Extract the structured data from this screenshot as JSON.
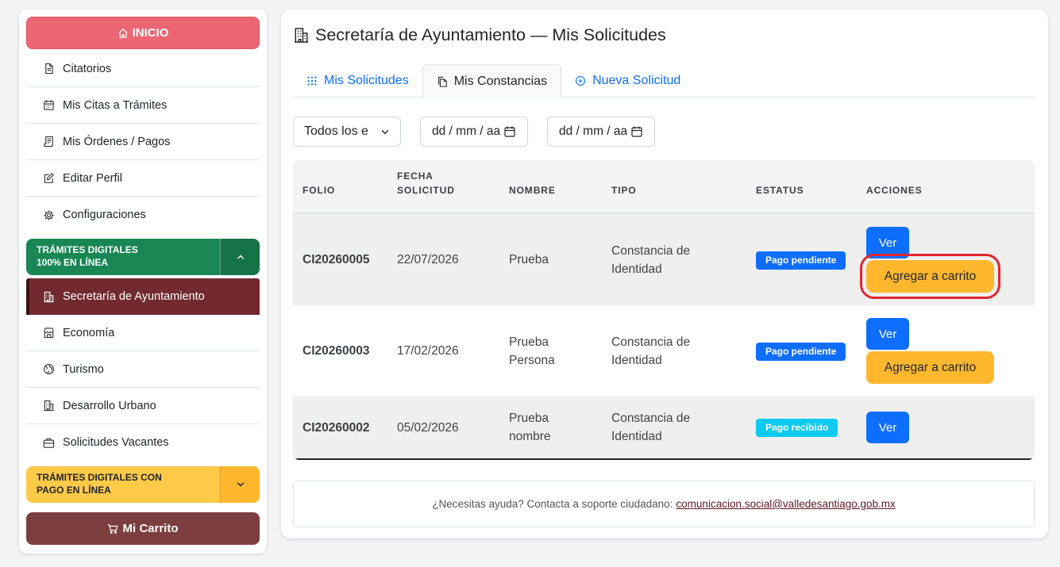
{
  "sidebar": {
    "inicio_label": "INICIO",
    "menu": [
      {
        "label": "Citatorios",
        "icon": "document-icon"
      },
      {
        "label": "Mis Citas a Trámites",
        "icon": "calendar-icon"
      },
      {
        "label": "Mis Órdenes / Pagos",
        "icon": "receipt-icon"
      },
      {
        "label": "Editar Perfil",
        "icon": "edit-icon"
      },
      {
        "label": "Configuraciones",
        "icon": "gear-icon"
      }
    ],
    "section_digital": {
      "line1": "TRÁMITES DIGITALES",
      "line2": "100% EN LÍNEA"
    },
    "digital_items": [
      {
        "label": "Secretaría de Ayuntamiento",
        "icon": "building-icon",
        "active": true
      },
      {
        "label": "Economía",
        "icon": "shop-icon"
      },
      {
        "label": "Turismo",
        "icon": "globe-icon"
      },
      {
        "label": "Desarrollo Urbano",
        "icon": "building-icon"
      },
      {
        "label": "Solicitudes Vacantes",
        "icon": "briefcase-icon"
      }
    ],
    "section_pago": {
      "line1": "TRÁMITES DIGITALES CON",
      "line2": "PAGO EN LÍNEA"
    },
    "carrito_label": "Mi Carrito"
  },
  "main": {
    "title": "Secretaría de Ayuntamiento — Mis Solicitudes",
    "tabs": [
      {
        "label": "Mis Solicitudes",
        "icon": "grid-dots-icon"
      },
      {
        "label": "Mis Constancias",
        "icon": "files-icon",
        "active": true
      },
      {
        "label": "Nueva Solicitud",
        "icon": "plus-circle-icon"
      }
    ],
    "filters": {
      "status_value": "Todos los e",
      "date_from": "dd / mm / aa",
      "date_to": "dd / mm / aa"
    },
    "table": {
      "headers": {
        "folio": "FOLIO",
        "fecha_1": "FECHA",
        "fecha_2": "SOLICITUD",
        "nombre": "NOMBRE",
        "tipo": "TIPO",
        "estatus": "ESTATUS",
        "acciones": "ACCIONES"
      },
      "rows": [
        {
          "folio": "CI20260005",
          "fecha": "22/07/2026",
          "nombre_1": "Prueba",
          "nombre_2": "",
          "tipo_1": "Constancia de",
          "tipo_2": "Identidad",
          "estatus": "Pago pendiente",
          "ver": "Ver",
          "cart": "Agregar a carrito"
        },
        {
          "folio": "CI20260003",
          "fecha": "17/02/2026",
          "nombre_1": "Prueba",
          "nombre_2": "Persona",
          "tipo_1": "Constancia de",
          "tipo_2": "Identidad",
          "estatus": "Pago pendiente",
          "ver": "Ver",
          "cart": "Agregar a carrito"
        },
        {
          "folio": "CI20260002",
          "fecha": "05/02/2026",
          "nombre_1": "Prueba",
          "nombre_2": "nombre",
          "tipo_1": "Constancia de",
          "tipo_2": "Identidad",
          "estatus": "Pago recibido",
          "ver": "Ver"
        }
      ]
    },
    "help": {
      "text": "¿Necesitas ayuda? Contacta a soporte ciudadano:",
      "email": "comunicacion.social@valledesantiago.gob.mx"
    }
  },
  "colors": {
    "inicio": "#ec6673",
    "green_section": "#198754",
    "active_item": "#722a2f",
    "yellow_section": "#ffca48",
    "carrito": "#7d3e3f",
    "primary": "#0d6efd",
    "cart_button": "#ffb82e",
    "highlight": "#e3262d"
  }
}
